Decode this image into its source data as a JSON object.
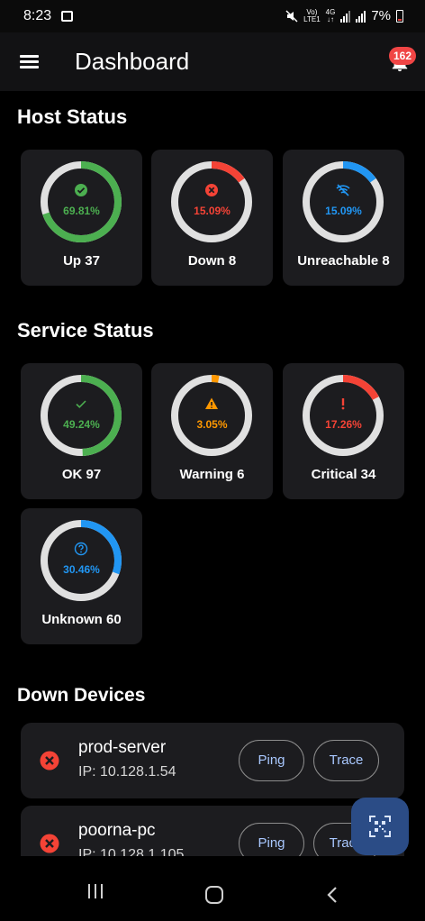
{
  "status_bar": {
    "time": "8:23",
    "network_top": "Vo)",
    "network_bottom": "LTE1",
    "net_gen_top": "4G",
    "battery": "7%"
  },
  "app_bar": {
    "title": "Dashboard",
    "notification_count": "162"
  },
  "host_status": {
    "title": "Host Status",
    "cards": [
      {
        "percent": "69.81%",
        "label": "Up 37",
        "value": 0.6981,
        "color": "#4caf50",
        "icon": "check-circle-icon"
      },
      {
        "percent": "15.09%",
        "label": "Down 8",
        "value": 0.1509,
        "color": "#f44336",
        "icon": "error-circle-icon"
      },
      {
        "percent": "15.09%",
        "label": "Unreachable 8",
        "value": 0.1509,
        "color": "#2196f3",
        "icon": "wifi-off-icon"
      }
    ]
  },
  "service_status": {
    "title": "Service Status",
    "cards": [
      {
        "percent": "49.24%",
        "label": "OK 97",
        "value": 0.4924,
        "color": "#4caf50",
        "icon": "check-icon"
      },
      {
        "percent": "3.05%",
        "label": "Warning 6",
        "value": 0.0305,
        "color": "#ff9800",
        "icon": "warning-icon"
      },
      {
        "percent": "17.26%",
        "label": "Critical 34",
        "value": 0.1726,
        "color": "#f44336",
        "icon": "exclamation-icon"
      },
      {
        "percent": "30.46%",
        "label": "Unknown 60",
        "value": 0.3046,
        "color": "#2196f3",
        "icon": "help-circle-icon"
      }
    ]
  },
  "down_devices": {
    "title": "Down Devices",
    "items": [
      {
        "name": "prod-server",
        "ip": "IP: 10.128.1.54",
        "ping": "Ping",
        "trace": "Trace"
      },
      {
        "name": "poorna-pc",
        "ip": "IP: 10.128.1.105",
        "ping": "Ping",
        "trace": "Trace"
      }
    ]
  },
  "colors": {
    "background": "#000000",
    "card": "#1c1c1f",
    "ring_track": "#e0e0e0",
    "fab": "#2b4c86",
    "badge": "#f04545",
    "pill_text": "#a9c8ff"
  }
}
